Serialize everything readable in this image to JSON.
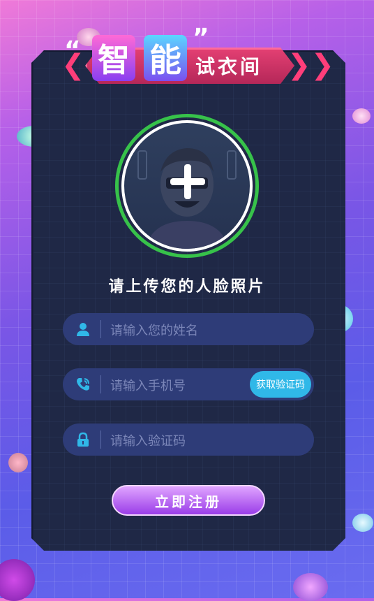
{
  "banner": {
    "quote_open": "“",
    "quote_close": "”",
    "char1": "智",
    "char2": "能",
    "rest": "试衣间"
  },
  "upload": {
    "prompt": "请上传您的人脸照片",
    "icon": "plus-icon"
  },
  "form": {
    "name_placeholder": "请输入您的姓名",
    "phone_placeholder": "请输入手机号",
    "code_button": "获取验证码",
    "code_placeholder": "请输入验证码",
    "submit_label": "立即注册"
  },
  "icons": {
    "name": "user-icon",
    "phone": "phone-icon",
    "code": "lock-icon"
  },
  "colors": {
    "accent": "#30b8e8",
    "ring": "#37c24a",
    "banner": "#e23f72",
    "submit": "#9a3de8"
  }
}
